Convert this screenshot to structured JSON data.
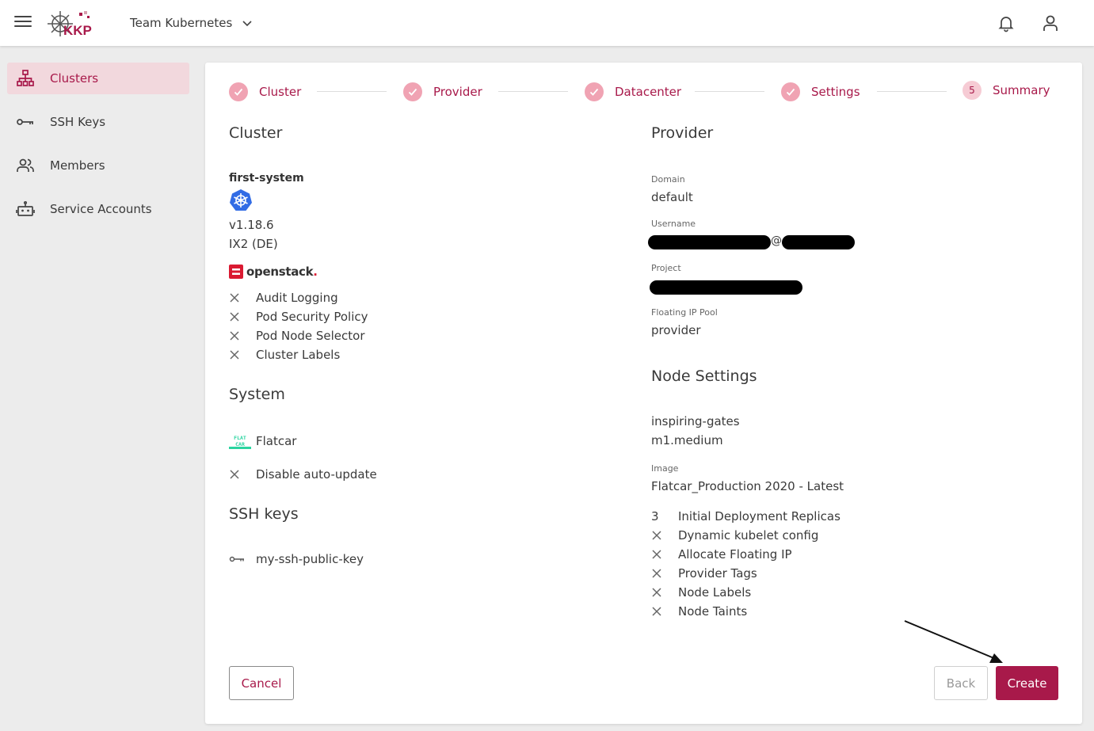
{
  "header": {
    "logo_text": "KKP",
    "project_name": "Team Kubernetes"
  },
  "sidebar": {
    "items": [
      {
        "label": "Clusters",
        "icon": "clusters-icon",
        "active": true
      },
      {
        "label": "SSH Keys",
        "icon": "key-icon",
        "active": false
      },
      {
        "label": "Members",
        "icon": "members-icon",
        "active": false
      },
      {
        "label": "Service Accounts",
        "icon": "robot-icon",
        "active": false
      }
    ]
  },
  "stepper": {
    "steps": [
      {
        "label": "Cluster",
        "state": "done"
      },
      {
        "label": "Provider",
        "state": "done"
      },
      {
        "label": "Datacenter",
        "state": "done"
      },
      {
        "label": "Settings",
        "state": "done"
      },
      {
        "label": "Summary",
        "state": "current",
        "number": "5"
      }
    ]
  },
  "cluster": {
    "title": "Cluster",
    "name": "first-system",
    "version": "v1.18.6",
    "datacenter": "IX2 (DE)",
    "provider_logo_text": "openstack",
    "features": [
      "Audit Logging",
      "Pod Security Policy",
      "Pod Node Selector",
      "Cluster Labels"
    ]
  },
  "system": {
    "title": "System",
    "os_name": "Flatcar",
    "os_logo_text": "FLAT CAR",
    "options": [
      "Disable auto-update"
    ]
  },
  "ssh_keys": {
    "title": "SSH keys",
    "keys": [
      "my-ssh-public-key"
    ]
  },
  "provider": {
    "title": "Provider",
    "domain_label": "Domain",
    "domain_value": "default",
    "username_label": "Username",
    "username_separator": "@",
    "project_label": "Project",
    "floating_ip_pool_label": "Floating IP Pool",
    "floating_ip_pool_value": "provider"
  },
  "node_settings": {
    "title": "Node Settings",
    "node_name": "inspiring-gates",
    "flavor": "m1.medium",
    "image_label": "Image",
    "image_value": "Flatcar_Production 2020 - Latest",
    "replicas_count": "3",
    "replicas_label": "Initial Deployment Replicas",
    "features": [
      "Dynamic kubelet config",
      "Allocate Floating IP",
      "Provider Tags",
      "Node Labels",
      "Node Taints"
    ]
  },
  "actions": {
    "cancel": "Cancel",
    "back": "Back",
    "create": "Create"
  },
  "colors": {
    "accent": "#a8194a",
    "step_done": "#f0a3b3",
    "active_bg": "#f2d8dd"
  }
}
